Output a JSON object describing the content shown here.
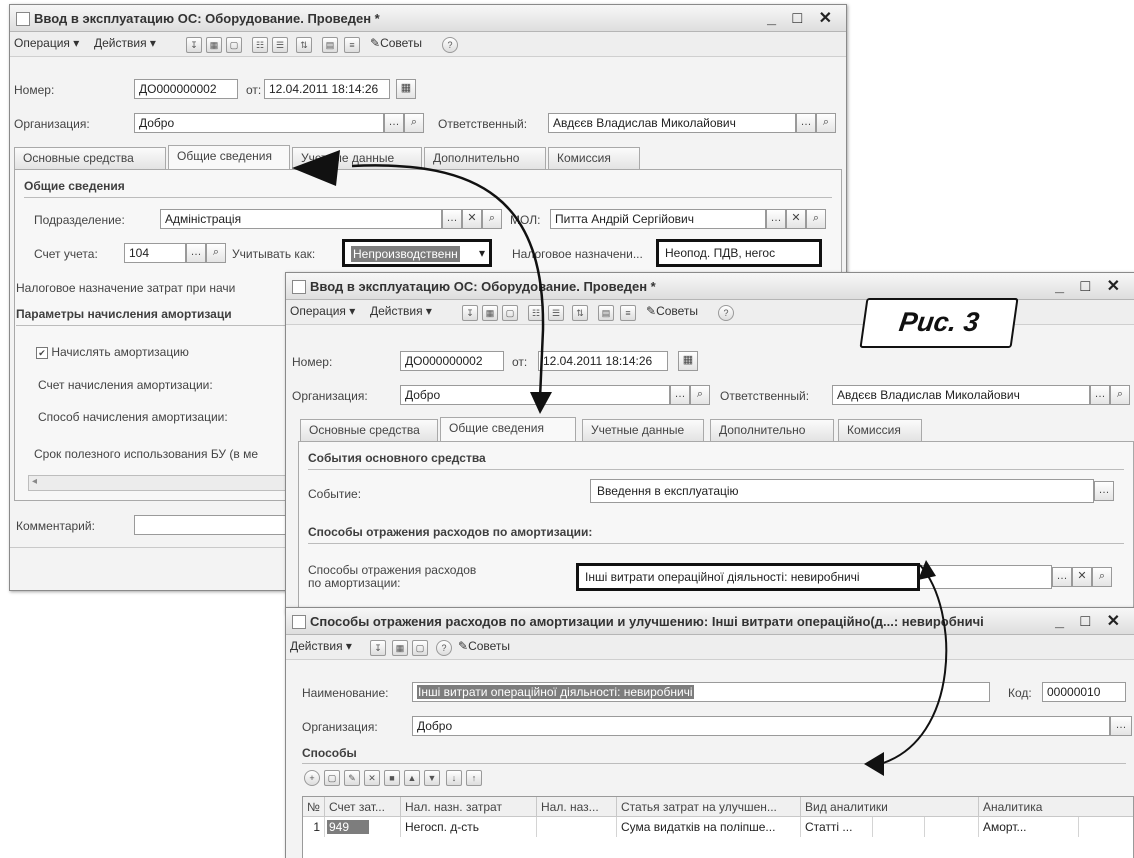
{
  "caption": "Рис. 3",
  "window1": {
    "title": "Ввод в эксплуатацию ОС: Оборудование. Проведен *",
    "toolbar": {
      "operation": "Операция ▾",
      "actions": "Действия ▾",
      "tips": "Советы"
    },
    "number_label": "Номер:",
    "number_value": "ДО000000002",
    "date_label": "от:",
    "date_value": "12.04.2011 18:14:26",
    "org_label": "Организация:",
    "org_value": "Добро",
    "resp_label": "Ответственный:",
    "resp_value": "Авдєєв Владислав Миколайович",
    "tabs": [
      "Основные средства",
      "Общие сведения",
      "Учетные данные",
      "Дополнительно",
      "Комиссия"
    ],
    "general_section": "Общие сведения",
    "dept_label": "Подразделение:",
    "dept_value": "Адміністрація",
    "mol_label": "МОЛ:",
    "mol_value": "Питта Андрій Сергійович",
    "account_label": "Счет учета:",
    "account_value": "104",
    "take_as_label": "Учитывать как:",
    "take_as_value": "Непроизводственн",
    "tax_purpose_label": "Налоговое назначени...",
    "tax_purpose_value": "Неопод. ПДВ, негос",
    "tax_cost_label": "Налоговое назначение затрат при начи",
    "depr_section": "Параметры начисления амортизаци",
    "charge_depr_label": "Начислять амортизацию",
    "charge_depr_checked": true,
    "depr_account_label": "Счет начисления амортизации:",
    "depr_method_label": "Способ начисления амортизации:",
    "useful_life_label": "Срок полезного использования БУ (в ме",
    "comment_label": "Комментарий:"
  },
  "window2": {
    "title": "Ввод в эксплуатацию ОС: Оборудование. Проведен *",
    "toolbar": {
      "operation": "Операция ▾",
      "actions": "Действия ▾",
      "tips": "Советы"
    },
    "number_label": "Номер:",
    "number_value": "ДО000000002",
    "date_label": "от:",
    "date_value": "12.04.2011 18:14:26",
    "org_label": "Организация:",
    "org_value": "Добро",
    "resp_label": "Ответственный:",
    "resp_value": "Авдєєв Владислав Миколайович",
    "tabs": [
      "Основные средства",
      "Общие сведения",
      "Учетные данные",
      "Дополнительно",
      "Комиссия"
    ],
    "events_section": "События основного средства",
    "event_label": "Событие:",
    "event_value": "Введення в експлуатацію",
    "expense_section": "Способы отражения расходов по амортизации:",
    "expense_label_1": "Способы отражения расходов",
    "expense_label_2": "по амортизации:",
    "expense_value": "Інші витрати операційної діяльності: невиробничі"
  },
  "window3": {
    "title": "Способы отражения расходов по амортизации и улучшению: Інші витрати операційно(д...: невиробничі",
    "toolbar": {
      "actions": "Действия ▾",
      "tips": "Советы"
    },
    "name_label": "Наименование:",
    "name_value": "Інші витрати операційної діяльності: невиробничі",
    "code_label": "Код:",
    "code_value": "00000010",
    "org_label": "Организация:",
    "org_value": "Добро",
    "methods_section": "Способы",
    "columns": [
      "№",
      "Счет зат...",
      "Нал. назн. затрат",
      "Нал. наз...",
      "Статья затрат на улучшен...",
      "Вид аналитики",
      "",
      "Аналитика",
      ""
    ],
    "rows": [
      [
        "1",
        "949",
        "Негосп. д-сть",
        "",
        "Сума видатків на поліпше...",
        "Статті ...",
        "",
        "Аморт...",
        ""
      ]
    ]
  }
}
